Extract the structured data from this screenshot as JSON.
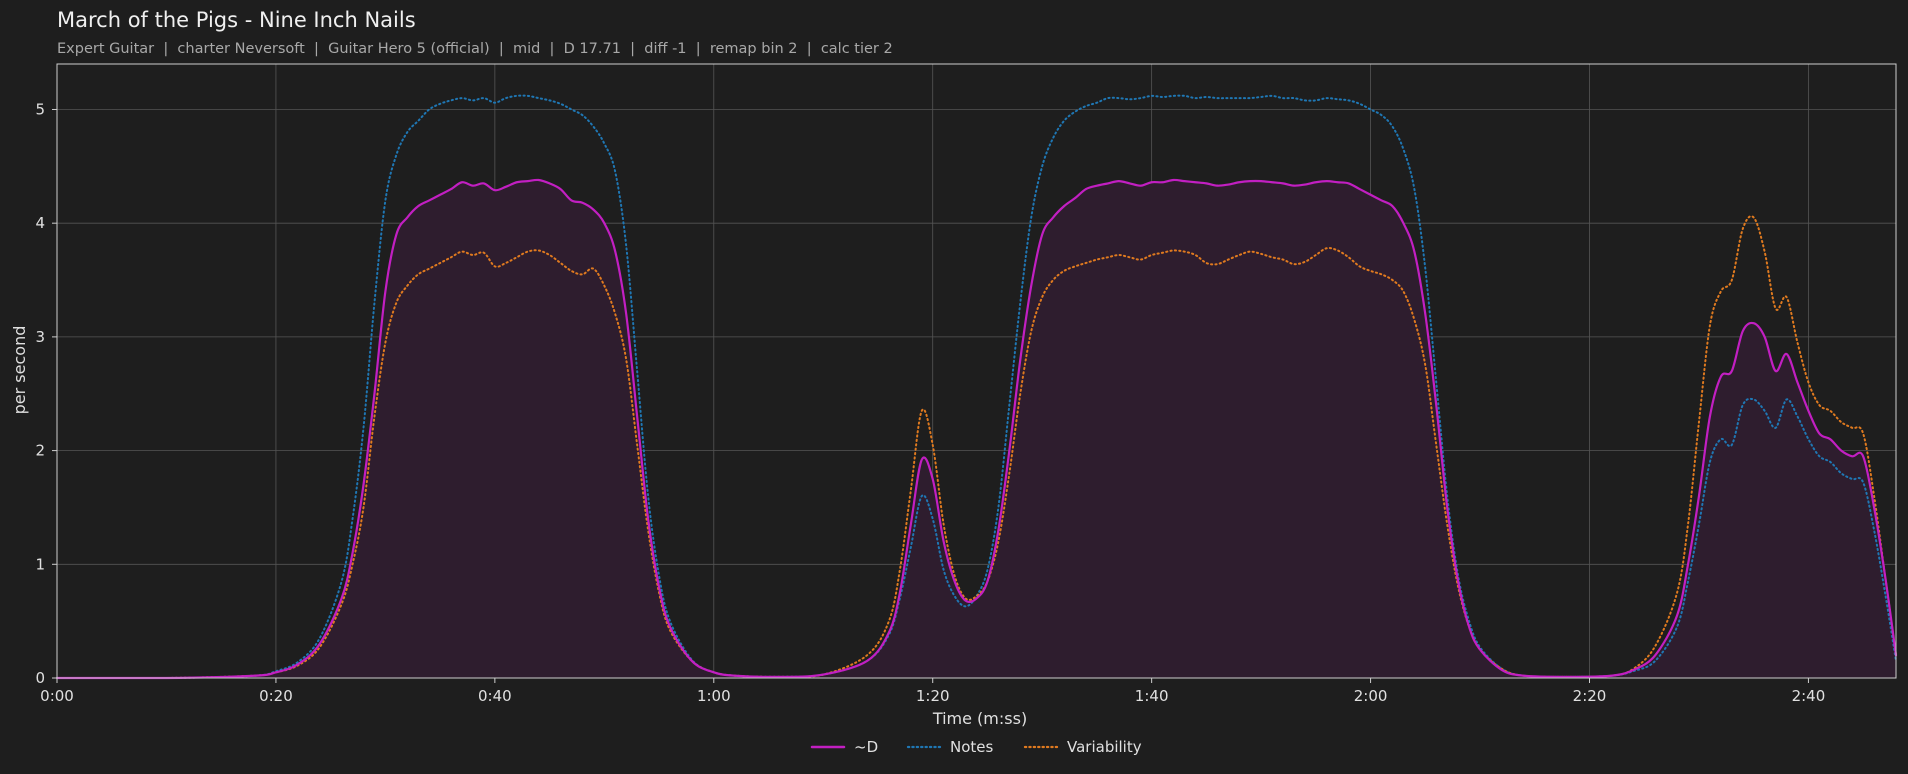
{
  "title": "March of the Pigs - Nine Inch Nails",
  "subtitle": "Expert Guitar  |  charter Neversoft  |  Guitar Hero 5 (official)  |  mid  |  D 17.71  |  diff -1  |  remap bin 2  |  calc tier 2",
  "colors": {
    "background": "#1e1e1e",
    "grid": "#555555",
    "axis": "#cfcfcf",
    "d_line": "#c21fc2",
    "d_fill": "#2e1d2e",
    "notes": "#1f77b4",
    "variability": "#e07a1f"
  },
  "chart_data": {
    "type": "line",
    "xlabel": "Time (m:ss)",
    "ylabel": "per second",
    "xlim": [
      0,
      168
    ],
    "ylim": [
      0,
      5.4
    ],
    "grid": true,
    "legend_placement": "bottom-center",
    "x_ticks": [
      0,
      20,
      40,
      60,
      80,
      100,
      120,
      140,
      160
    ],
    "x_tick_labels": [
      "0:00",
      "0:20",
      "0:40",
      "1:00",
      "1:20",
      "1:40",
      "2:00",
      "2:20",
      "2:40"
    ],
    "y_ticks": [
      0,
      1,
      2,
      3,
      4,
      5
    ],
    "y_tick_labels": [
      "0",
      "1",
      "2",
      "3",
      "4",
      "5"
    ],
    "x": [
      0,
      10,
      18,
      20,
      22,
      24,
      26,
      27,
      28,
      29,
      30,
      31,
      32,
      33,
      34,
      35,
      36,
      37,
      38,
      39,
      40,
      41,
      42,
      43,
      44,
      45,
      46,
      47,
      48,
      49,
      50,
      51,
      52,
      53,
      54,
      55,
      56,
      58,
      60,
      62,
      66,
      70,
      74,
      76,
      77,
      78,
      79,
      80,
      81,
      82,
      83,
      84,
      85,
      86,
      87,
      88,
      89,
      90,
      91,
      92,
      93,
      94,
      95,
      96,
      97,
      98,
      99,
      100,
      101,
      102,
      103,
      104,
      105,
      106,
      107,
      108,
      109,
      110,
      111,
      112,
      113,
      114,
      115,
      116,
      117,
      118,
      119,
      120,
      121,
      122,
      123,
      124,
      125,
      126,
      127,
      128,
      129,
      130,
      132,
      134,
      138,
      142,
      144,
      146,
      148,
      149,
      150,
      151,
      152,
      153,
      154,
      155,
      156,
      157,
      158,
      159,
      160,
      161,
      162,
      163,
      164,
      165,
      166,
      167,
      168
    ],
    "series": [
      {
        "name": "~D",
        "style": "solid-filled",
        "values": [
          0.0,
          0.0,
          0.02,
          0.05,
          0.12,
          0.3,
          0.7,
          1.1,
          1.7,
          2.5,
          3.4,
          3.9,
          4.05,
          4.15,
          4.2,
          4.25,
          4.3,
          4.36,
          4.33,
          4.35,
          4.29,
          4.32,
          4.36,
          4.37,
          4.38,
          4.35,
          4.3,
          4.2,
          4.18,
          4.12,
          4.0,
          3.75,
          3.2,
          2.3,
          1.4,
          0.8,
          0.45,
          0.15,
          0.05,
          0.02,
          0.01,
          0.03,
          0.15,
          0.4,
          0.75,
          1.35,
          1.92,
          1.75,
          1.2,
          0.85,
          0.68,
          0.7,
          0.85,
          1.3,
          2.0,
          2.8,
          3.45,
          3.9,
          4.05,
          4.15,
          4.22,
          4.3,
          4.33,
          4.35,
          4.37,
          4.35,
          4.33,
          4.36,
          4.36,
          4.38,
          4.37,
          4.36,
          4.35,
          4.33,
          4.34,
          4.36,
          4.37,
          4.37,
          4.36,
          4.35,
          4.33,
          4.34,
          4.36,
          4.37,
          4.36,
          4.35,
          4.3,
          4.25,
          4.2,
          4.15,
          4.0,
          3.75,
          3.2,
          2.4,
          1.5,
          0.85,
          0.45,
          0.25,
          0.07,
          0.02,
          0.01,
          0.02,
          0.07,
          0.2,
          0.55,
          1.0,
          1.6,
          2.3,
          2.65,
          2.7,
          3.05,
          3.12,
          3.0,
          2.7,
          2.85,
          2.6,
          2.35,
          2.15,
          2.1,
          2.0,
          1.95,
          1.95,
          1.5,
          0.9,
          0.2
        ]
      },
      {
        "name": "Notes",
        "style": "dotted",
        "values": [
          0.0,
          0.0,
          0.02,
          0.06,
          0.14,
          0.35,
          0.85,
          1.4,
          2.2,
          3.3,
          4.2,
          4.6,
          4.8,
          4.9,
          5.0,
          5.05,
          5.08,
          5.1,
          5.08,
          5.1,
          5.06,
          5.1,
          5.12,
          5.12,
          5.1,
          5.08,
          5.05,
          5.0,
          4.95,
          4.85,
          4.7,
          4.45,
          3.8,
          2.7,
          1.6,
          0.9,
          0.5,
          0.16,
          0.05,
          0.02,
          0.01,
          0.03,
          0.15,
          0.38,
          0.7,
          1.15,
          1.6,
          1.4,
          0.95,
          0.72,
          0.63,
          0.72,
          0.95,
          1.5,
          2.4,
          3.3,
          4.05,
          4.5,
          4.75,
          4.9,
          4.98,
          5.03,
          5.06,
          5.1,
          5.1,
          5.09,
          5.1,
          5.12,
          5.11,
          5.12,
          5.12,
          5.1,
          5.11,
          5.1,
          5.1,
          5.1,
          5.1,
          5.11,
          5.12,
          5.1,
          5.1,
          5.08,
          5.08,
          5.1,
          5.09,
          5.08,
          5.05,
          5.0,
          4.95,
          4.85,
          4.65,
          4.3,
          3.6,
          2.6,
          1.6,
          0.9,
          0.5,
          0.27,
          0.08,
          0.02,
          0.01,
          0.02,
          0.06,
          0.15,
          0.45,
          0.85,
          1.35,
          1.9,
          2.1,
          2.05,
          2.4,
          2.45,
          2.35,
          2.2,
          2.45,
          2.3,
          2.1,
          1.95,
          1.9,
          1.8,
          1.75,
          1.72,
          1.3,
          0.75,
          0.15
        ]
      },
      {
        "name": "Variability",
        "style": "dotted",
        "values": [
          0.0,
          0.0,
          0.02,
          0.05,
          0.11,
          0.27,
          0.65,
          1.0,
          1.5,
          2.3,
          2.95,
          3.3,
          3.45,
          3.55,
          3.6,
          3.65,
          3.7,
          3.75,
          3.72,
          3.74,
          3.62,
          3.65,
          3.7,
          3.75,
          3.76,
          3.72,
          3.65,
          3.58,
          3.55,
          3.6,
          3.45,
          3.2,
          2.8,
          2.05,
          1.3,
          0.75,
          0.42,
          0.15,
          0.05,
          0.02,
          0.01,
          0.03,
          0.2,
          0.5,
          0.95,
          1.65,
          2.35,
          2.05,
          1.35,
          0.9,
          0.7,
          0.72,
          0.85,
          1.2,
          1.8,
          2.5,
          3.05,
          3.35,
          3.5,
          3.58,
          3.62,
          3.65,
          3.68,
          3.7,
          3.72,
          3.7,
          3.68,
          3.72,
          3.74,
          3.76,
          3.75,
          3.72,
          3.65,
          3.64,
          3.68,
          3.72,
          3.75,
          3.73,
          3.7,
          3.68,
          3.64,
          3.66,
          3.72,
          3.78,
          3.76,
          3.7,
          3.62,
          3.58,
          3.55,
          3.5,
          3.4,
          3.15,
          2.75,
          2.05,
          1.35,
          0.8,
          0.45,
          0.25,
          0.08,
          0.02,
          0.01,
          0.02,
          0.08,
          0.28,
          0.75,
          1.35,
          2.25,
          3.1,
          3.4,
          3.5,
          3.95,
          4.05,
          3.75,
          3.25,
          3.35,
          2.95,
          2.6,
          2.4,
          2.35,
          2.25,
          2.2,
          2.15,
          1.6,
          0.9,
          0.2
        ]
      }
    ]
  }
}
